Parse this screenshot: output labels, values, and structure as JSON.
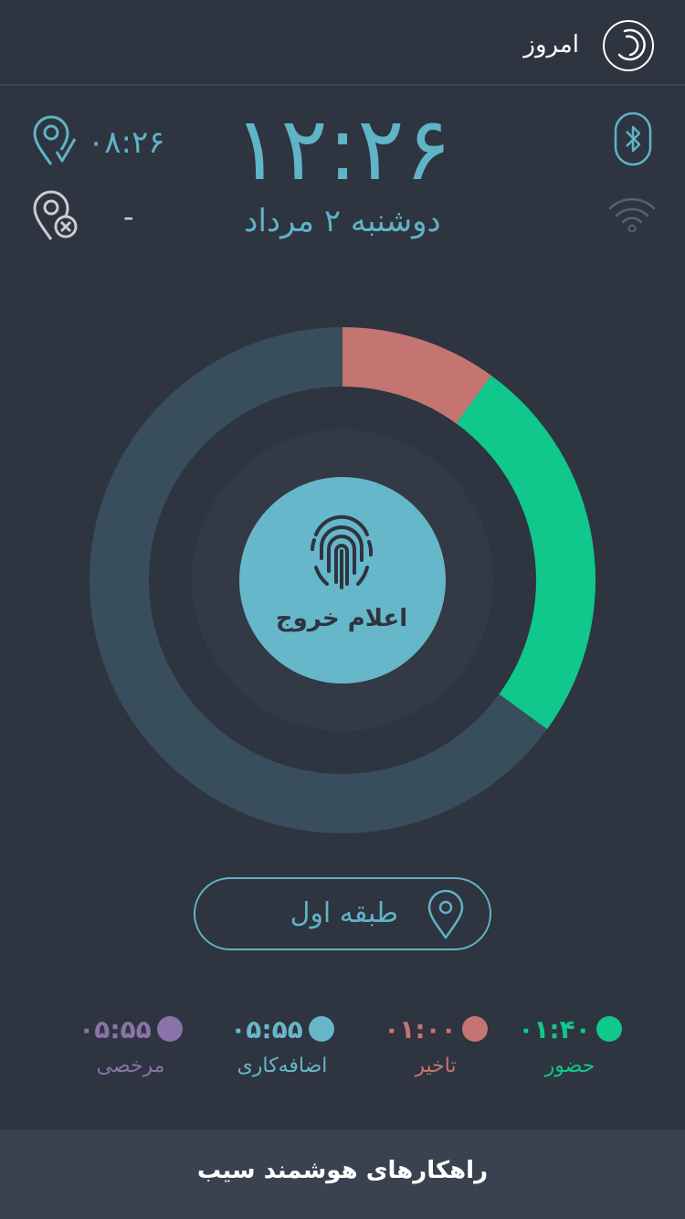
{
  "header": {
    "title": "امروز",
    "logo_icon": "app-logo-icon"
  },
  "clock": {
    "time": "۱۲:۲۶",
    "date": "دوشنبه ۲ مرداد"
  },
  "attendance": {
    "checkin_time": "۰۸:۲۶",
    "checkout_time": "-",
    "checkin_icon": "location-check-icon",
    "checkout_icon": "location-cancel-icon"
  },
  "status_icons": {
    "bluetooth": "bluetooth-icon",
    "wifi": "wifi-icon"
  },
  "ring": {
    "segments": [
      {
        "name": "تاخیر",
        "fraction": 0.1,
        "color": "#c47571"
      },
      {
        "name": "حضور",
        "fraction": 0.25,
        "color": "#10c78c"
      }
    ],
    "track_color": "#394e5c"
  },
  "action": {
    "label": "اعلام خروج",
    "icon": "fingerprint-icon",
    "color": "#66b7c9"
  },
  "location": {
    "label": "طبقه اول",
    "icon": "location-pin-icon"
  },
  "stats": [
    {
      "label": "حضور",
      "value": "۰۱:۴۰",
      "color": "#10c78c"
    },
    {
      "label": "تاخیر",
      "value": "۰۱:۰۰",
      "color": "#c47571"
    },
    {
      "label": "اضافه‌کاری",
      "value": "۰۵:۵۵",
      "color": "#66b7c9"
    },
    {
      "label": "مرخصی",
      "value": "۰۵:۵۵",
      "color": "#8a73a8"
    }
  ],
  "footer": {
    "text": "راهکارهای هوشمند سیب"
  }
}
